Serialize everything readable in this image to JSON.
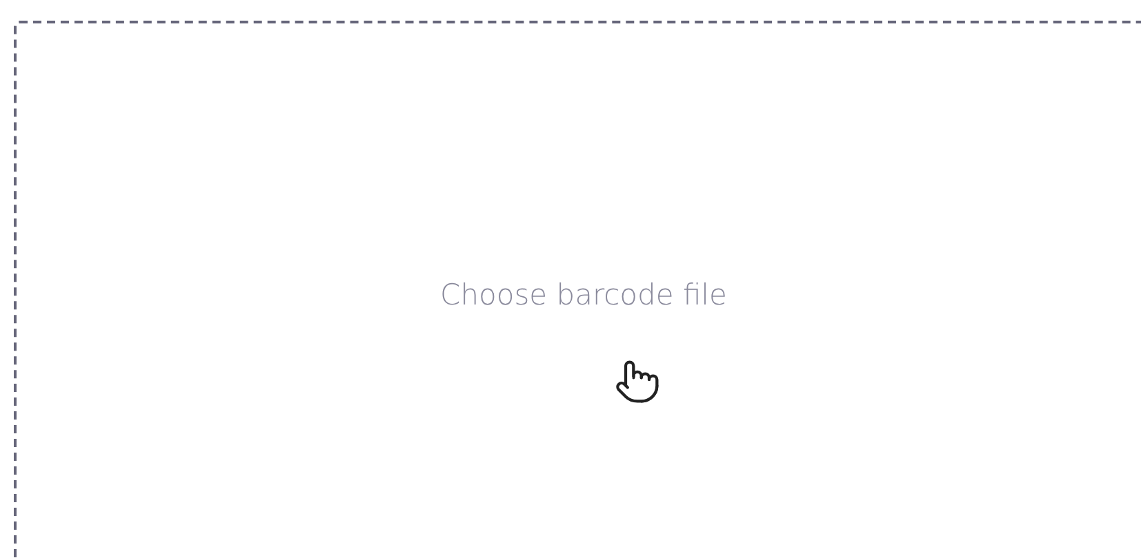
{
  "dropzone": {
    "label": "Choose barcode file"
  }
}
